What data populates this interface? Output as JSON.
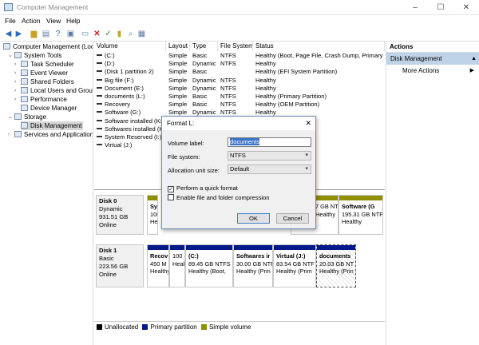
{
  "window": {
    "title": "Computer Management",
    "min": "–",
    "max": "☐",
    "close": "✕"
  },
  "menu": [
    "File",
    "Action",
    "View",
    "Help"
  ],
  "toolbar": [
    "back-icon",
    "forward-icon",
    "up-folder-icon",
    "properties-icon",
    "help-icon",
    "console-icon",
    "delete-icon",
    "checkmark-icon",
    "new-icon",
    "search-icon",
    "console-tree-icon"
  ],
  "tree": [
    {
      "label": "Computer Management (Local",
      "level": 0
    },
    {
      "label": "System Tools",
      "level": 1,
      "arrow": "⌄"
    },
    {
      "label": "Task Scheduler",
      "level": 2,
      "arrow": "›"
    },
    {
      "label": "Event Viewer",
      "level": 2,
      "arrow": "›"
    },
    {
      "label": "Shared Folders",
      "level": 2,
      "arrow": "›"
    },
    {
      "label": "Local Users and Groups",
      "level": 2,
      "arrow": "›"
    },
    {
      "label": "Performance",
      "level": 2,
      "arrow": "›"
    },
    {
      "label": "Device Manager",
      "level": 2
    },
    {
      "label": "Storage",
      "level": 1,
      "arrow": "⌄"
    },
    {
      "label": "Disk Management",
      "level": 2,
      "selected": true
    },
    {
      "label": "Services and Applications",
      "level": 1,
      "arrow": "›"
    }
  ],
  "columns": [
    "Volume",
    "Layout",
    "Type",
    "File System",
    "Status"
  ],
  "volumes": [
    [
      "(C:)",
      "Simple",
      "Basic",
      "NTFS",
      "Healthy (Boot, Page File, Crash Dump, Primary Par"
    ],
    [
      "(D:)",
      "Simple",
      "Dynamic",
      "NTFS",
      "Healthy"
    ],
    [
      "(Disk 1 partition 2)",
      "Simple",
      "Basic",
      "",
      "Healthy (EFI System Partition)"
    ],
    [
      "Big file (F:)",
      "Simple",
      "Dynamic",
      "NTFS",
      "Healthy"
    ],
    [
      "Document (E:)",
      "Simple",
      "Dynamic",
      "NTFS",
      "Healthy"
    ],
    [
      "documents (L:)",
      "Simple",
      "Basic",
      "NTFS",
      "Healthy (Primary Partition)"
    ],
    [
      "Recovery",
      "Simple",
      "Basic",
      "NTFS",
      "Healthy (OEM Partition)"
    ],
    [
      "Software (G:)",
      "Simple",
      "Dynamic",
      "NTFS",
      "Healthy"
    ],
    [
      "Software installed (K:)",
      "",
      "",
      "",
      ""
    ],
    [
      "Softwares installed (H:)",
      "",
      "",
      "",
      ""
    ],
    [
      "System Reserved (I:)",
      "",
      "",
      "",
      ""
    ],
    [
      "Virtual (J:)",
      "",
      "",
      "",
      ""
    ]
  ],
  "disks": [
    {
      "name": "Disk 0",
      "type": "Dynamic",
      "size": "931.51 GB",
      "state": "Online",
      "parts": [
        {
          "l1": "Sy:",
          "l2": "100",
          "l3": "He",
          "color": "#8f8f00"
        },
        {
          "l1": "",
          "l2": "7 GB NT",
          "l3": "Healthy",
          "color": "#8f8f00"
        },
        {
          "l1": "Software (G",
          "l2": "195.31 GB NTF",
          "l3": "Healthy",
          "color": "#8f8f00"
        }
      ]
    },
    {
      "name": "Disk 1",
      "type": "Basic",
      "size": "223.56 GB",
      "state": "Online",
      "parts": [
        {
          "l1": "Recov",
          "l2": "450 M",
          "l3": "Healthy",
          "color": "#001a8c"
        },
        {
          "l1": "",
          "l2": "100",
          "l3": "Health",
          "color": "#001a8c"
        },
        {
          "l1": "(C:)",
          "l2": "89.45 GB NTFS",
          "l3": "Healthy (Boot,",
          "color": "#001a8c"
        },
        {
          "l1": "Softwares ir",
          "l2": "30.00 GB NTF",
          "l3": "Healthy (Prin",
          "color": "#001a8c"
        },
        {
          "l1": "Virtual  (J:)",
          "l2": "83.54 GB NTF",
          "l3": "Healthy (Prim",
          "color": "#001a8c"
        },
        {
          "l1": "documents",
          "l2": "20.03 GB NT",
          "l3": "Healthy (Prin",
          "color": "#001a8c"
        }
      ]
    }
  ],
  "legend": [
    {
      "label": "Unallocated",
      "color": "#000000"
    },
    {
      "label": "Primary partition",
      "color": "#001a8c"
    },
    {
      "label": "Simple volume",
      "color": "#8f8f00"
    }
  ],
  "actions": {
    "header": "Actions",
    "selected": "Disk Management",
    "more": "More Actions"
  },
  "dialog": {
    "title": "Format L:",
    "volume_label_label": "Volume label:",
    "volume_label_value": "documents",
    "fs_label": "File system:",
    "fs_value": "NTFS",
    "alloc_label": "Allocation unit size:",
    "alloc_value": "Default",
    "quick_format": "Perform a quick format",
    "quick_checked": true,
    "compression": "Enable file and folder compression",
    "compression_checked": false,
    "ok": "OK",
    "cancel": "Cancel"
  }
}
